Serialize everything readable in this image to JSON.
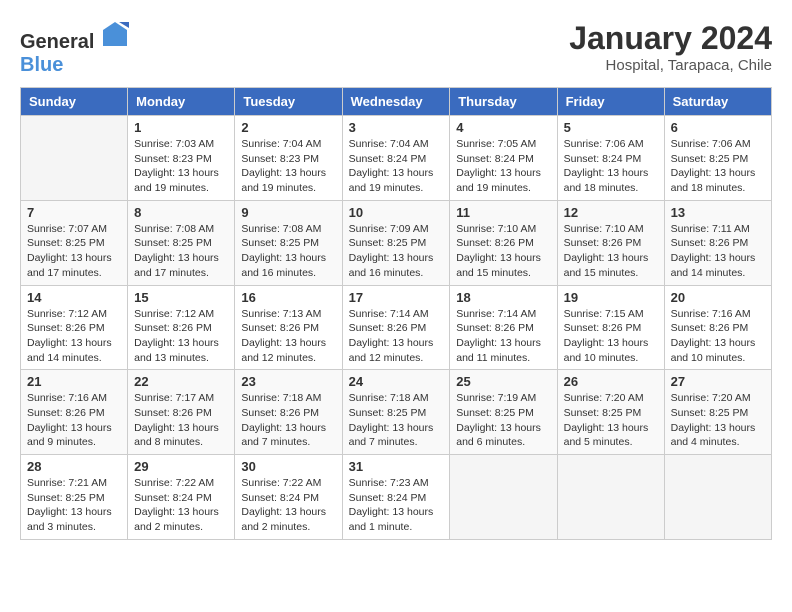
{
  "header": {
    "logo_general": "General",
    "logo_blue": "Blue",
    "month_year": "January 2024",
    "location": "Hospital, Tarapaca, Chile"
  },
  "days_of_week": [
    "Sunday",
    "Monday",
    "Tuesday",
    "Wednesday",
    "Thursday",
    "Friday",
    "Saturday"
  ],
  "weeks": [
    [
      {
        "day": "",
        "sunrise": "",
        "sunset": "",
        "daylight": ""
      },
      {
        "day": "1",
        "sunrise": "Sunrise: 7:03 AM",
        "sunset": "Sunset: 8:23 PM",
        "daylight": "Daylight: 13 hours and 19 minutes."
      },
      {
        "day": "2",
        "sunrise": "Sunrise: 7:04 AM",
        "sunset": "Sunset: 8:23 PM",
        "daylight": "Daylight: 13 hours and 19 minutes."
      },
      {
        "day": "3",
        "sunrise": "Sunrise: 7:04 AM",
        "sunset": "Sunset: 8:24 PM",
        "daylight": "Daylight: 13 hours and 19 minutes."
      },
      {
        "day": "4",
        "sunrise": "Sunrise: 7:05 AM",
        "sunset": "Sunset: 8:24 PM",
        "daylight": "Daylight: 13 hours and 19 minutes."
      },
      {
        "day": "5",
        "sunrise": "Sunrise: 7:06 AM",
        "sunset": "Sunset: 8:24 PM",
        "daylight": "Daylight: 13 hours and 18 minutes."
      },
      {
        "day": "6",
        "sunrise": "Sunrise: 7:06 AM",
        "sunset": "Sunset: 8:25 PM",
        "daylight": "Daylight: 13 hours and 18 minutes."
      }
    ],
    [
      {
        "day": "7",
        "sunrise": "Sunrise: 7:07 AM",
        "sunset": "Sunset: 8:25 PM",
        "daylight": "Daylight: 13 hours and 17 minutes."
      },
      {
        "day": "8",
        "sunrise": "Sunrise: 7:08 AM",
        "sunset": "Sunset: 8:25 PM",
        "daylight": "Daylight: 13 hours and 17 minutes."
      },
      {
        "day": "9",
        "sunrise": "Sunrise: 7:08 AM",
        "sunset": "Sunset: 8:25 PM",
        "daylight": "Daylight: 13 hours and 16 minutes."
      },
      {
        "day": "10",
        "sunrise": "Sunrise: 7:09 AM",
        "sunset": "Sunset: 8:25 PM",
        "daylight": "Daylight: 13 hours and 16 minutes."
      },
      {
        "day": "11",
        "sunrise": "Sunrise: 7:10 AM",
        "sunset": "Sunset: 8:26 PM",
        "daylight": "Daylight: 13 hours and 15 minutes."
      },
      {
        "day": "12",
        "sunrise": "Sunrise: 7:10 AM",
        "sunset": "Sunset: 8:26 PM",
        "daylight": "Daylight: 13 hours and 15 minutes."
      },
      {
        "day": "13",
        "sunrise": "Sunrise: 7:11 AM",
        "sunset": "Sunset: 8:26 PM",
        "daylight": "Daylight: 13 hours and 14 minutes."
      }
    ],
    [
      {
        "day": "14",
        "sunrise": "Sunrise: 7:12 AM",
        "sunset": "Sunset: 8:26 PM",
        "daylight": "Daylight: 13 hours and 14 minutes."
      },
      {
        "day": "15",
        "sunrise": "Sunrise: 7:12 AM",
        "sunset": "Sunset: 8:26 PM",
        "daylight": "Daylight: 13 hours and 13 minutes."
      },
      {
        "day": "16",
        "sunrise": "Sunrise: 7:13 AM",
        "sunset": "Sunset: 8:26 PM",
        "daylight": "Daylight: 13 hours and 12 minutes."
      },
      {
        "day": "17",
        "sunrise": "Sunrise: 7:14 AM",
        "sunset": "Sunset: 8:26 PM",
        "daylight": "Daylight: 13 hours and 12 minutes."
      },
      {
        "day": "18",
        "sunrise": "Sunrise: 7:14 AM",
        "sunset": "Sunset: 8:26 PM",
        "daylight": "Daylight: 13 hours and 11 minutes."
      },
      {
        "day": "19",
        "sunrise": "Sunrise: 7:15 AM",
        "sunset": "Sunset: 8:26 PM",
        "daylight": "Daylight: 13 hours and 10 minutes."
      },
      {
        "day": "20",
        "sunrise": "Sunrise: 7:16 AM",
        "sunset": "Sunset: 8:26 PM",
        "daylight": "Daylight: 13 hours and 10 minutes."
      }
    ],
    [
      {
        "day": "21",
        "sunrise": "Sunrise: 7:16 AM",
        "sunset": "Sunset: 8:26 PM",
        "daylight": "Daylight: 13 hours and 9 minutes."
      },
      {
        "day": "22",
        "sunrise": "Sunrise: 7:17 AM",
        "sunset": "Sunset: 8:26 PM",
        "daylight": "Daylight: 13 hours and 8 minutes."
      },
      {
        "day": "23",
        "sunrise": "Sunrise: 7:18 AM",
        "sunset": "Sunset: 8:26 PM",
        "daylight": "Daylight: 13 hours and 7 minutes."
      },
      {
        "day": "24",
        "sunrise": "Sunrise: 7:18 AM",
        "sunset": "Sunset: 8:25 PM",
        "daylight": "Daylight: 13 hours and 7 minutes."
      },
      {
        "day": "25",
        "sunrise": "Sunrise: 7:19 AM",
        "sunset": "Sunset: 8:25 PM",
        "daylight": "Daylight: 13 hours and 6 minutes."
      },
      {
        "day": "26",
        "sunrise": "Sunrise: 7:20 AM",
        "sunset": "Sunset: 8:25 PM",
        "daylight": "Daylight: 13 hours and 5 minutes."
      },
      {
        "day": "27",
        "sunrise": "Sunrise: 7:20 AM",
        "sunset": "Sunset: 8:25 PM",
        "daylight": "Daylight: 13 hours and 4 minutes."
      }
    ],
    [
      {
        "day": "28",
        "sunrise": "Sunrise: 7:21 AM",
        "sunset": "Sunset: 8:25 PM",
        "daylight": "Daylight: 13 hours and 3 minutes."
      },
      {
        "day": "29",
        "sunrise": "Sunrise: 7:22 AM",
        "sunset": "Sunset: 8:24 PM",
        "daylight": "Daylight: 13 hours and 2 minutes."
      },
      {
        "day": "30",
        "sunrise": "Sunrise: 7:22 AM",
        "sunset": "Sunset: 8:24 PM",
        "daylight": "Daylight: 13 hours and 2 minutes."
      },
      {
        "day": "31",
        "sunrise": "Sunrise: 7:23 AM",
        "sunset": "Sunset: 8:24 PM",
        "daylight": "Daylight: 13 hours and 1 minute."
      },
      {
        "day": "",
        "sunrise": "",
        "sunset": "",
        "daylight": ""
      },
      {
        "day": "",
        "sunrise": "",
        "sunset": "",
        "daylight": ""
      },
      {
        "day": "",
        "sunrise": "",
        "sunset": "",
        "daylight": ""
      }
    ]
  ]
}
